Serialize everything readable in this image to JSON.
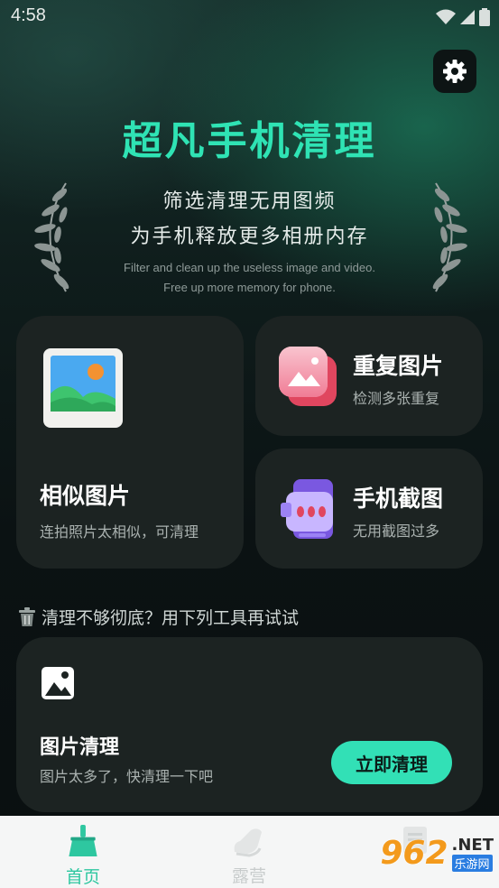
{
  "status_bar": {
    "time": "4:58"
  },
  "hero": {
    "title": "超凡手机清理",
    "subtitle_line1": "筛选清理无用图频",
    "subtitle_line2": "为手机释放更多相册内存",
    "en_line1": "Filter and clean up the useless image and video.",
    "en_line2": "Free up more memory for phone."
  },
  "cards": {
    "similar": {
      "title": "相似图片",
      "desc": "连拍照片太相似，可清理"
    },
    "duplicate": {
      "title": "重复图片",
      "desc": "检测多张重复"
    },
    "screenshot": {
      "title": "手机截图",
      "desc": "无用截图过多"
    }
  },
  "tip": {
    "text": "清理不够彻底？用下列工具再试试"
  },
  "photo_clean": {
    "title": "图片清理",
    "desc": "图片太多了，快清理一下吧",
    "button": "立即清理"
  },
  "tabs": [
    {
      "label": "首页",
      "active": true
    },
    {
      "label": "露营",
      "active": false
    }
  ],
  "watermark": {
    "number": "962",
    "suffix": ".NET",
    "site": "乐游网"
  },
  "colors": {
    "accent": "#32e0b6",
    "card_bg": "#1c2322",
    "tab_active": "#2ec7a0"
  }
}
